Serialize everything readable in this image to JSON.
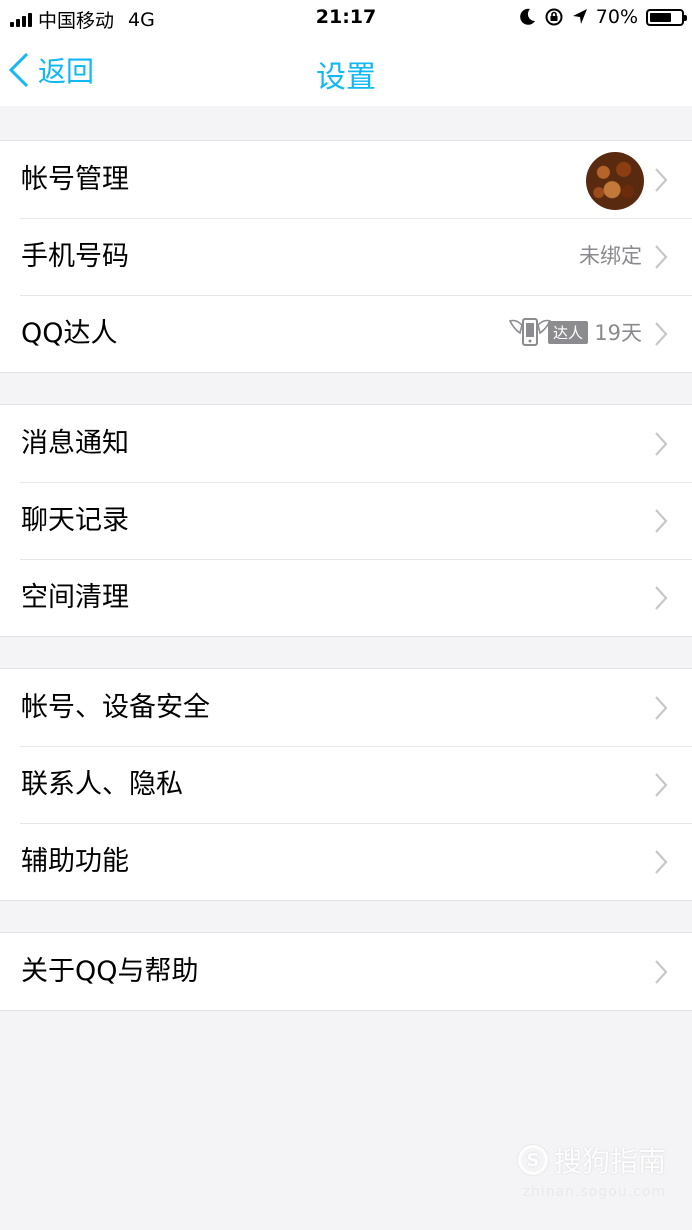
{
  "status_bar": {
    "carrier": "中国移动",
    "network": "4G",
    "time": "21:17",
    "battery_percent": "70%",
    "battery_level": 0.7
  },
  "nav": {
    "back_label": "返回",
    "title": "设置"
  },
  "groups": [
    {
      "rows": [
        {
          "label": "帐号管理"
        },
        {
          "label": "手机号码",
          "value": "未绑定"
        },
        {
          "label": "QQ达人",
          "badge": "达人",
          "days": "19天"
        }
      ]
    },
    {
      "rows": [
        {
          "label": "消息通知"
        },
        {
          "label": "聊天记录"
        },
        {
          "label": "空间清理"
        }
      ]
    },
    {
      "rows": [
        {
          "label": "帐号、设备安全"
        },
        {
          "label": "联系人、隐私"
        },
        {
          "label": "辅助功能"
        }
      ]
    },
    {
      "rows": [
        {
          "label": "关于QQ与帮助"
        }
      ]
    }
  ],
  "watermark": {
    "logo_letter": "S",
    "brand": "搜狗指南",
    "url": "zhinan.sogou.com"
  },
  "colors": {
    "accent": "#12b7f5",
    "background": "#f4f4f6",
    "secondary_text": "#8a8a8e"
  }
}
